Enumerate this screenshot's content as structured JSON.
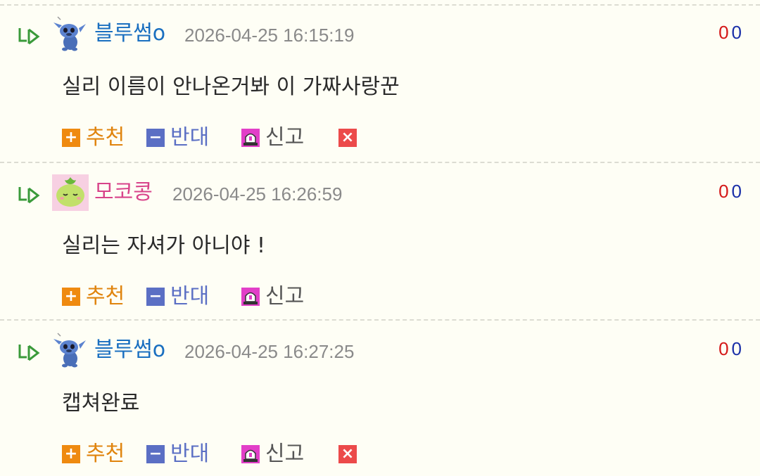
{
  "comments": [
    {
      "nickname": "블루썸o",
      "nick_color": "blue",
      "avatar": "stitch-avatar-icon",
      "date": "2026-04-25 16:15:19",
      "up_count": "0",
      "down_count": "0",
      "text": "실리 이름이 안나온거봐 이 가짜사랑꾼",
      "show_delete": true
    },
    {
      "nickname": "모코콩",
      "nick_color": "pink",
      "avatar": "mokoko-avatar-icon",
      "date": "2026-04-25 16:26:59",
      "up_count": "0",
      "down_count": "0",
      "text": "실리는 자셔가 아니야 !",
      "show_delete": false
    },
    {
      "nickname": "블루썸o",
      "nick_color": "blue",
      "avatar": "stitch-avatar-icon",
      "date": "2026-04-25 16:27:25",
      "up_count": "0",
      "down_count": "0",
      "text": "캡쳐완료",
      "show_delete": true
    }
  ],
  "actions": {
    "recommend_label": "추천",
    "oppose_label": "반대",
    "report_label": "신고",
    "plus_glyph": "+",
    "minus_glyph": "−",
    "delete_glyph": "×"
  },
  "colors": {
    "background": "#fefef5",
    "nick_blue": "#1a6fc0",
    "nick_pink": "#d8438a",
    "up_count": "#d41818",
    "down_count": "#1a2fa8",
    "recommend": "#ef8a10",
    "oppose": "#5b6fc4",
    "delete": "#ec4a4a"
  }
}
